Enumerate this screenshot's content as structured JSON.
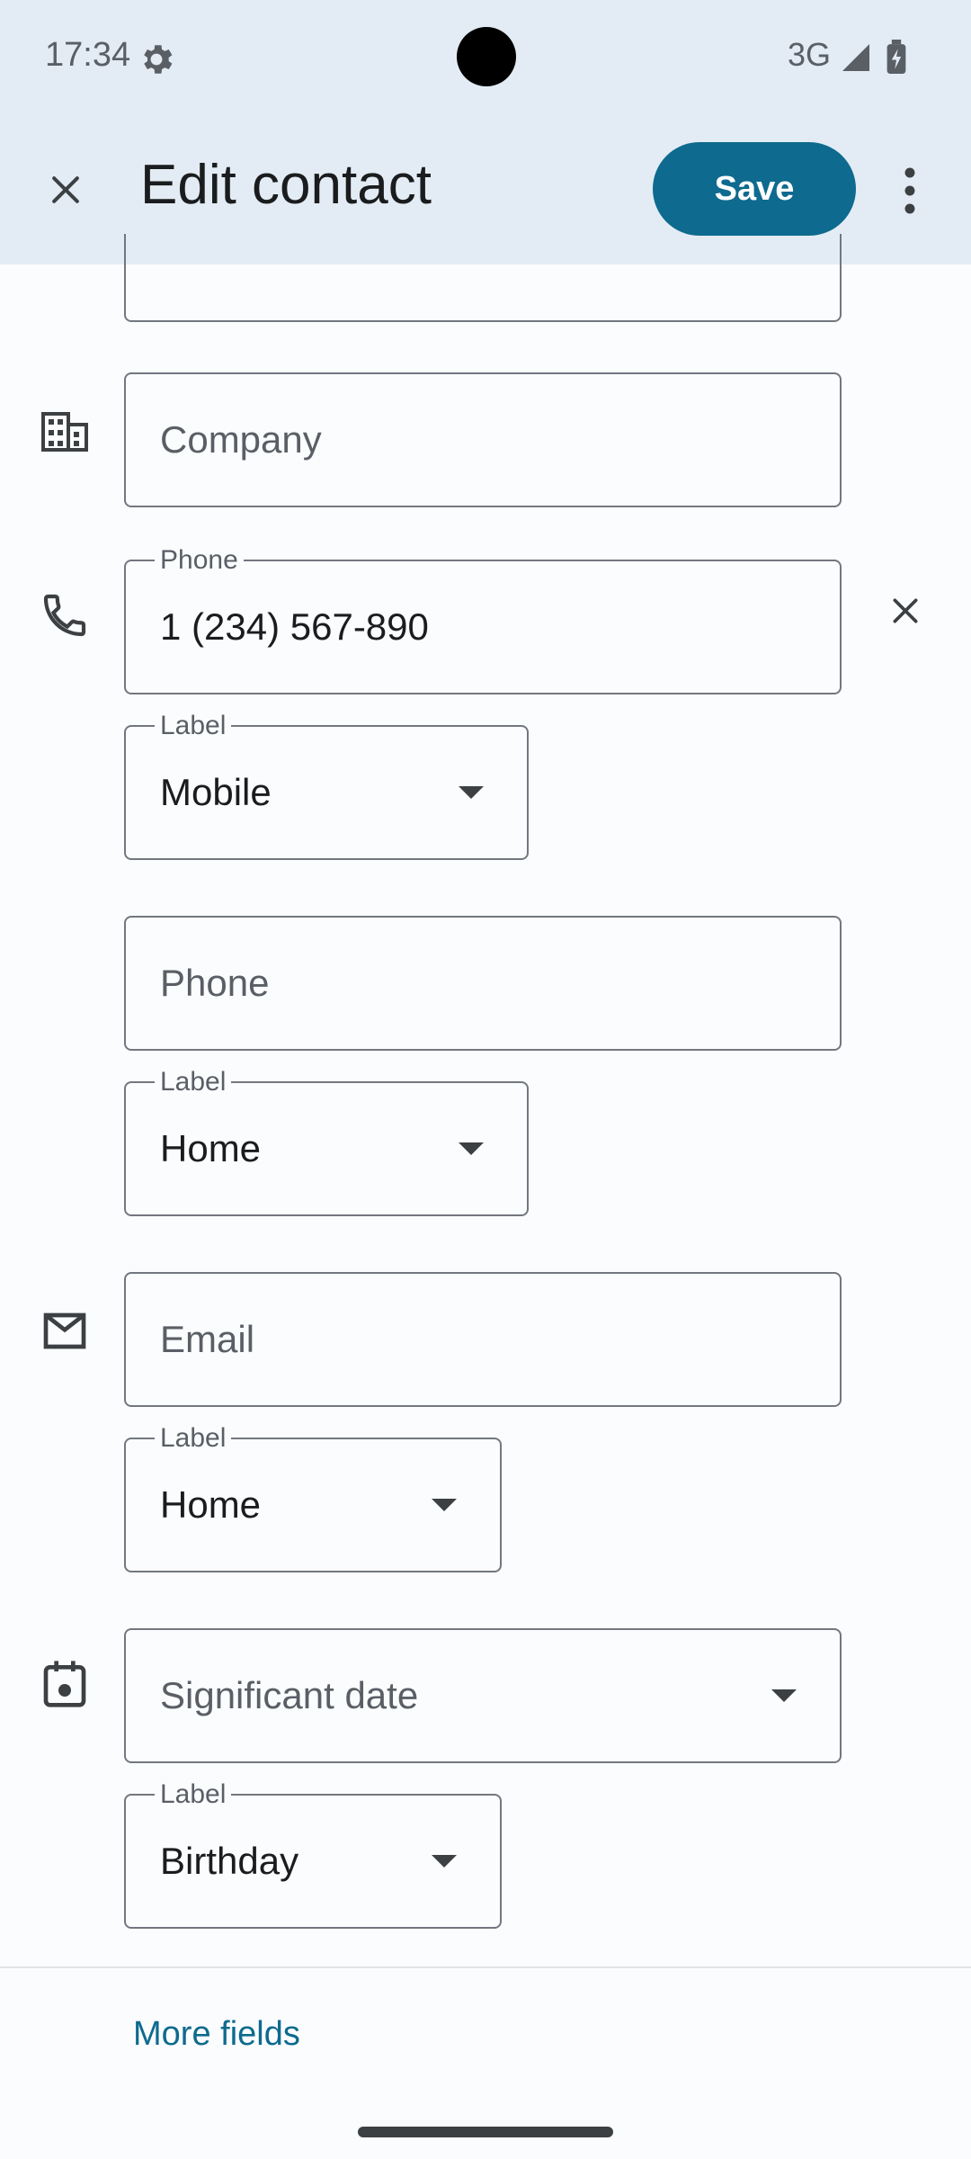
{
  "status_bar": {
    "time": "17:34",
    "network": "3G",
    "icons": [
      "gear-icon",
      "signal-icon",
      "battery-icon"
    ]
  },
  "app_bar": {
    "title": "Edit contact",
    "save_label": "Save",
    "icons": [
      "close-icon",
      "more-vert-icon"
    ]
  },
  "form": {
    "company": {
      "placeholder": "Company"
    },
    "phone1": {
      "label": "Phone",
      "value": "1 (234) 567-890",
      "type_label": "Label",
      "type_value": "Mobile"
    },
    "phone2": {
      "placeholder": "Phone",
      "type_label": "Label",
      "type_value": "Home"
    },
    "email": {
      "placeholder": "Email",
      "type_label": "Label",
      "type_value": "Home"
    },
    "date": {
      "placeholder": "Significant date",
      "type_label": "Label",
      "type_value": "Birthday"
    },
    "icons": [
      "company-icon",
      "phone-icon",
      "email-icon",
      "calendar-icon",
      "remove-icon",
      "dropdown-arrow-icon"
    ]
  },
  "footer": {
    "more_fields": "More fields"
  },
  "colors": {
    "accent": "#0E6A8E",
    "bar_bg": "#E3ECF4",
    "page_bg": "#FBFCFE"
  }
}
